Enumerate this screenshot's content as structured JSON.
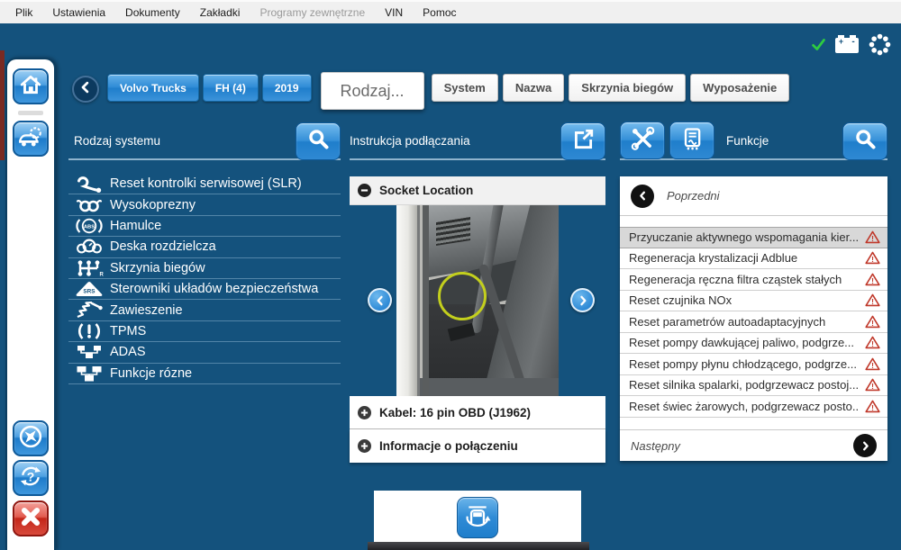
{
  "menu": {
    "items": [
      "Plik",
      "Ustawienia",
      "Dokumenty",
      "Zakładki",
      "Programy zewnętrzne",
      "VIN",
      "Pomoc"
    ],
    "disabled_item": "Programy zewnętrzne"
  },
  "statusbar": {
    "icons": [
      "connection-ok-check",
      "battery",
      "busy-spinner"
    ]
  },
  "nav": {
    "vehicle_buttons": [
      "Volvo Trucks",
      "FH (4)",
      "2019"
    ],
    "active_filter_label": "Rodzaj...",
    "filter_buttons": [
      "System",
      "Nazwa",
      "Skrzynia biegów",
      "Wyposażenie"
    ]
  },
  "system_panel": {
    "title": "Rodzaj systemu",
    "items": [
      {
        "icon": "wrench-icon",
        "label": "Reset kontrolki serwisowej (SLR)"
      },
      {
        "icon": "injector-icon",
        "label": "Wysokoprezny"
      },
      {
        "icon": "abs-icon",
        "label": "Hamulce"
      },
      {
        "icon": "dashboard-icon",
        "label": "Deska rozdzielcza"
      },
      {
        "icon": "gearbox-icon",
        "label": "Skrzynia biegów"
      },
      {
        "icon": "srs-icon",
        "label": "Sterowniki układów bezpieczeństwa"
      },
      {
        "icon": "suspension-icon",
        "label": "Zawieszenie"
      },
      {
        "icon": "tpms-icon",
        "label": "TPMS"
      },
      {
        "icon": "adas-icon",
        "label": "ADAS"
      },
      {
        "icon": "misc-functions-icon",
        "label": "Funkcje rózne"
      }
    ]
  },
  "instruction_panel": {
    "title": "Instrukcja podłączania",
    "socket_section": "Socket Location",
    "cable_section": "Kabel: 16 pin OBD (J1962)",
    "info_section": "Informacje o połączeniu"
  },
  "functions_panel": {
    "title": "Funkcje",
    "previous_label": "Poprzedni",
    "next_label": "Następny",
    "items": [
      {
        "label": "Przyuczanie aktywnego wspomagania kier...",
        "warning": true,
        "selected": true
      },
      {
        "label": "Regeneracja krystalizacji Adblue",
        "warning": true,
        "selected": false
      },
      {
        "label": "Regeneracja ręczna filtra cząstek stałych",
        "warning": true,
        "selected": false
      },
      {
        "label": "Reset czujnika NOx",
        "warning": true,
        "selected": false
      },
      {
        "label": "Reset parametrów autoadaptacyjnych",
        "warning": true,
        "selected": false
      },
      {
        "label": "Reset pompy dawkującej paliwo, podgrze...",
        "warning": true,
        "selected": false
      },
      {
        "label": "Reset pompy płynu chłodzącego, podgrze...",
        "warning": true,
        "selected": false
      },
      {
        "label": "Reset silnika spalarki, podgrzewacz postoj...",
        "warning": true,
        "selected": false
      },
      {
        "label": "Reset świec żarowych, podgrzewacz posto...",
        "warning": true,
        "selected": false
      }
    ]
  },
  "colors": {
    "background_blue": "#14527d",
    "accent_blue": "#2e8ad6",
    "warning_red": "#c0392b",
    "check_green": "#2ecc40",
    "highlight_yellow": "#c3cf1d"
  }
}
